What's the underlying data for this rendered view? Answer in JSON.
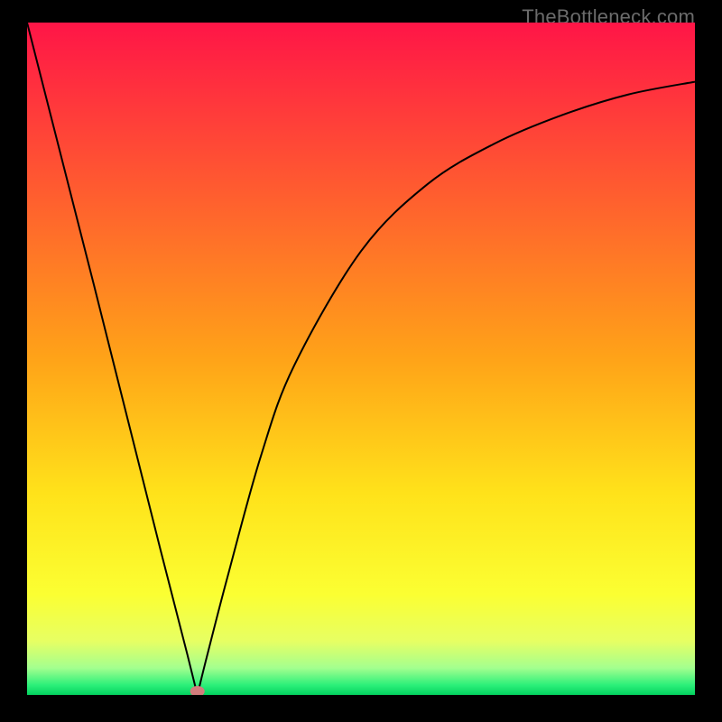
{
  "attribution": "TheBottleneck.com",
  "chart_data": {
    "type": "line",
    "title": "",
    "xlabel": "",
    "ylabel": "",
    "xlim": [
      0,
      1
    ],
    "ylim": [
      0,
      1
    ],
    "grid": false,
    "legend": false,
    "minimum_marker": {
      "x": 0.255,
      "y": 0.0,
      "color": "#d27d7d"
    },
    "series": [
      {
        "name": "curve",
        "x": [
          0.0,
          0.1,
          0.2,
          0.24,
          0.255,
          0.27,
          0.3,
          0.35,
          0.4,
          0.5,
          0.6,
          0.7,
          0.8,
          0.9,
          1.0
        ],
        "y": [
          1.0,
          0.61,
          0.215,
          0.06,
          0.0,
          0.06,
          0.175,
          0.355,
          0.49,
          0.66,
          0.76,
          0.82,
          0.862,
          0.893,
          0.912
        ]
      }
    ],
    "background_gradient": {
      "stops": [
        {
          "offset": 0.0,
          "color": "#ff1547"
        },
        {
          "offset": 0.5,
          "color": "#ffa318"
        },
        {
          "offset": 0.7,
          "color": "#ffe21a"
        },
        {
          "offset": 0.85,
          "color": "#fbff32"
        },
        {
          "offset": 0.92,
          "color": "#e7ff63"
        },
        {
          "offset": 0.96,
          "color": "#a3ff8f"
        },
        {
          "offset": 0.985,
          "color": "#2df07a"
        },
        {
          "offset": 1.0,
          "color": "#03d25f"
        }
      ]
    },
    "line_color": "#000000",
    "line_width": 2.0
  }
}
